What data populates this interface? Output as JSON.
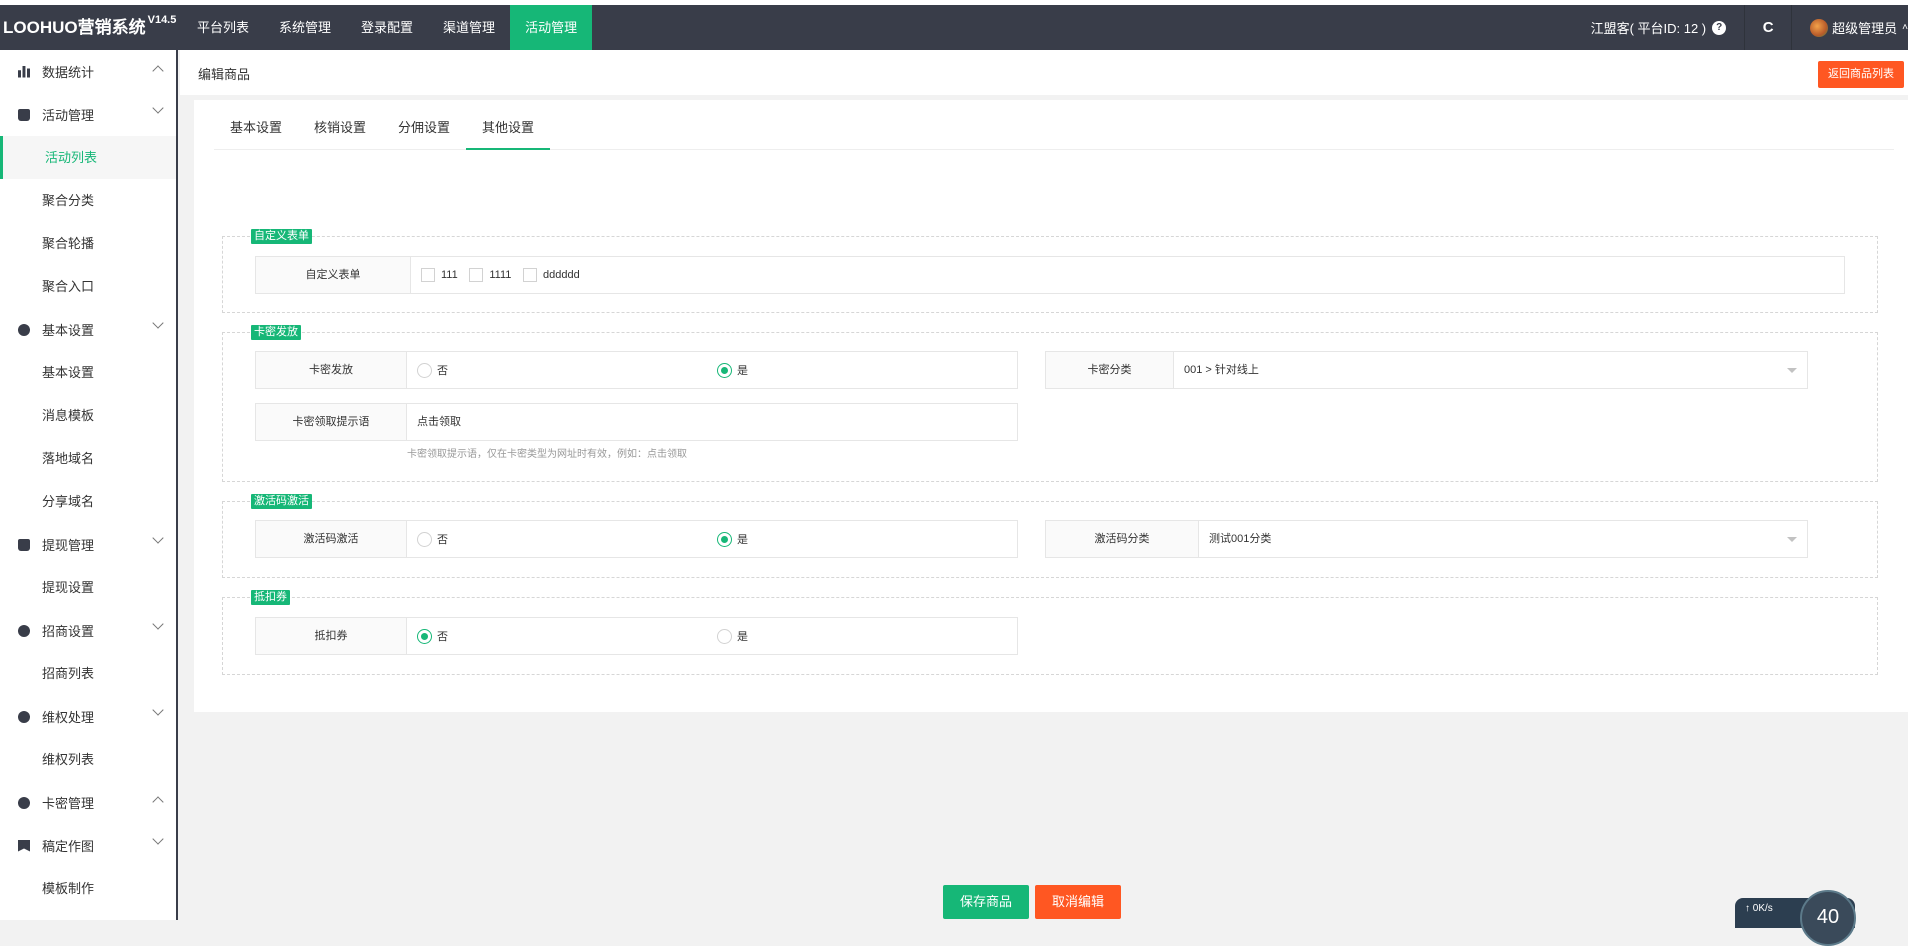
{
  "app": {
    "title": "LOOHUO营销系统",
    "version": "V14.5"
  },
  "topnav": [
    {
      "label": "平台列表"
    },
    {
      "label": "系统管理"
    },
    {
      "label": "登录配置"
    },
    {
      "label": "渠道管理"
    },
    {
      "label": "活动管理",
      "active": true
    }
  ],
  "topright": {
    "platform": "江盟客( 平台ID: 12 )",
    "help_icon": "question-circle-icon",
    "refresh": "C",
    "user": "超级管理员"
  },
  "sidebar": [
    {
      "label": "数据统计",
      "icon": "bar-chart-icon",
      "expanded": false
    },
    {
      "label": "活动管理",
      "icon": "bag-icon",
      "expanded": true,
      "items": [
        {
          "label": "活动列表",
          "active": true
        },
        {
          "label": "聚合分类"
        },
        {
          "label": "聚合轮播"
        },
        {
          "label": "聚合入口"
        }
      ]
    },
    {
      "label": "基本设置",
      "icon": "settings-icon",
      "expanded": true,
      "items": [
        {
          "label": "基本设置"
        },
        {
          "label": "消息模板"
        },
        {
          "label": "落地域名"
        },
        {
          "label": "分享域名"
        }
      ]
    },
    {
      "label": "提现管理",
      "icon": "money-bag-icon",
      "expanded": true,
      "items": [
        {
          "label": "提现设置"
        }
      ]
    },
    {
      "label": "招商设置",
      "icon": "compass-icon",
      "expanded": true,
      "items": [
        {
          "label": "招商列表"
        }
      ]
    },
    {
      "label": "维权处理",
      "icon": "shield-icon",
      "expanded": true,
      "items": [
        {
          "label": "维权列表"
        }
      ]
    },
    {
      "label": "卡密管理",
      "icon": "card-icon",
      "expanded": false
    },
    {
      "label": "稿定作图",
      "icon": "bookmark-icon",
      "expanded": true,
      "items": [
        {
          "label": "模板制作"
        }
      ]
    }
  ],
  "page": {
    "title": "编辑商品",
    "back_button": "返回商品列表"
  },
  "tabs": [
    {
      "label": "基本设置"
    },
    {
      "label": "核销设置"
    },
    {
      "label": "分佣设置"
    },
    {
      "label": "其他设置",
      "active": true
    }
  ],
  "sections": {
    "custom_form": {
      "legend": "自定义表单",
      "label": "自定义表单",
      "options": [
        {
          "label": "111",
          "checked": false
        },
        {
          "label": "1111",
          "checked": false
        },
        {
          "label": "dddddd",
          "checked": false
        }
      ]
    },
    "card_issue": {
      "legend": "卡密发放",
      "issue_label": "卡密发放",
      "no": "否",
      "yes": "是",
      "selected": "是",
      "category_label": "卡密分类",
      "category_value": "001 > 针对线上",
      "prompt_label": "卡密领取提示语",
      "prompt_value": "点击领取",
      "prompt_hint": "卡密领取提示语，仅在卡密类型为网址时有效，例如：点击领取"
    },
    "activation": {
      "legend": "激活码激活",
      "label": "激活码激活",
      "no": "否",
      "yes": "是",
      "selected": "是",
      "category_label": "激活码分类",
      "category_value": "测试001分类"
    },
    "coupon": {
      "legend": "抵扣券",
      "label": "抵扣券",
      "no": "否",
      "yes": "是",
      "selected": "否"
    }
  },
  "actions": {
    "save": "保存商品",
    "cancel": "取消编辑"
  },
  "netwidget": {
    "speed": "0K/s",
    "gauge": "40"
  },
  "colors": {
    "primary": "#16b777",
    "danger": "#ff5722",
    "header": "#393d49"
  }
}
